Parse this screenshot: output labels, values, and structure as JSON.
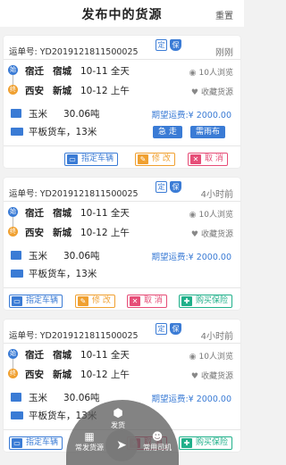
{
  "header": {
    "title": "发布中的货源",
    "reset": "重置"
  },
  "labels": {
    "waybill": "运单号:",
    "views_suffix": "人浏览",
    "fav": "收藏货源",
    "price_label": "期望运费:",
    "ding": "定",
    "bao": "保"
  },
  "cards": [
    {
      "waybill": "YD2019121811500025",
      "time": "刚刚",
      "from": {
        "city": "宿迁",
        "district": "宿城",
        "date": "10-11 全天"
      },
      "to": {
        "city": "西安",
        "district": "新城",
        "date": "10-12 上午"
      },
      "views": "10",
      "goods": "玉米",
      "weight": "30.06吨",
      "price": "¥ 2000.00",
      "truck": "平板货车，13米",
      "tags": [
        "急 走",
        "需雨布"
      ],
      "buttons": [
        "指定车辆",
        "修 改",
        "取 消"
      ]
    },
    {
      "waybill": "YD2019121811500025",
      "time": "4小时前",
      "from": {
        "city": "宿迁",
        "district": "宿城",
        "date": "10-11 全天"
      },
      "to": {
        "city": "西安",
        "district": "新城",
        "date": "10-12 上午"
      },
      "views": "10",
      "goods": "玉米",
      "weight": "30.06吨",
      "price": "¥ 2000.00",
      "truck": "平板货车，13米",
      "tags": [],
      "buttons": [
        "指定车辆",
        "修 改",
        "取 消",
        "购买保险"
      ]
    },
    {
      "waybill": "YD2019121811500025",
      "time": "4小时前",
      "from": {
        "city": "宿迁",
        "district": "宿城",
        "date": "10-11 全天"
      },
      "to": {
        "city": "西安",
        "district": "新城",
        "date": "10-12 上午"
      },
      "views": "10",
      "goods": "玉米",
      "weight": "30.06吨",
      "price": "¥ 2000.00",
      "truck": "平板货车，13米",
      "tags": [],
      "buttons": [
        "指定车辆",
        "修 改",
        "取 消",
        "购买保险"
      ]
    }
  ],
  "fab": {
    "publish": "发货",
    "common_goods": "常发货源",
    "common_driver": "常用司机"
  },
  "colors": {
    "accent": "#3a7bd5",
    "orange": "#f0a030",
    "pink": "#e64d77",
    "green": "#20b08a"
  }
}
